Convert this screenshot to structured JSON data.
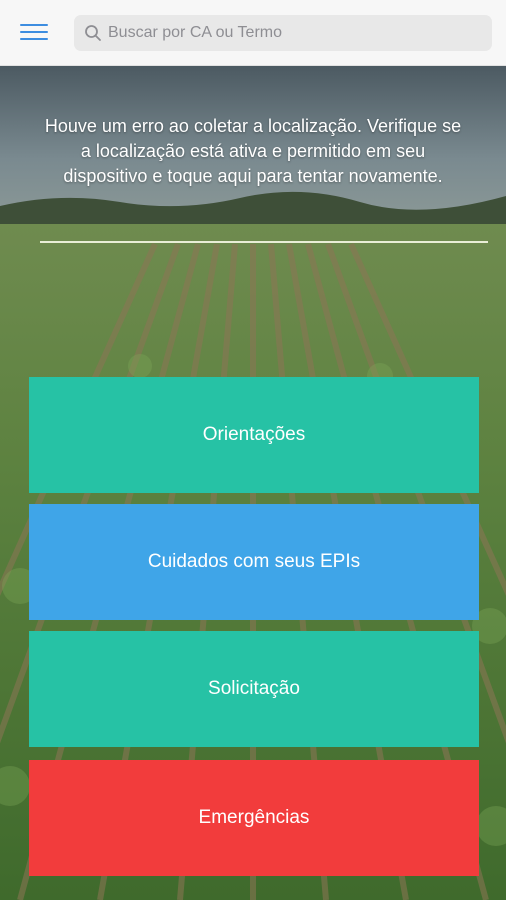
{
  "header": {
    "menu_icon": "hamburger-menu-icon",
    "search": {
      "placeholder": "Buscar por CA ou Termo",
      "value": "",
      "icon": "search-icon"
    }
  },
  "main": {
    "background": "crop-field-photo",
    "location_error": "Houve um erro ao coletar a localização. Verifique se a localização está ativa e permitido em seu dispositivo e toque aqui para tentar novamente.",
    "tiles": [
      {
        "label": "Orientações",
        "color": "#26c2a5"
      },
      {
        "label": "Cuidados com seus EPIs",
        "color": "#3fa5e8"
      },
      {
        "label": "Solicitação",
        "color": "#26c2a5"
      },
      {
        "label": "Emergências",
        "color": "#f23c3c"
      }
    ]
  },
  "colors": {
    "accent": "#3d8de0",
    "teal": "#26c2a5",
    "blue": "#3fa5e8",
    "red": "#f23c3c"
  }
}
